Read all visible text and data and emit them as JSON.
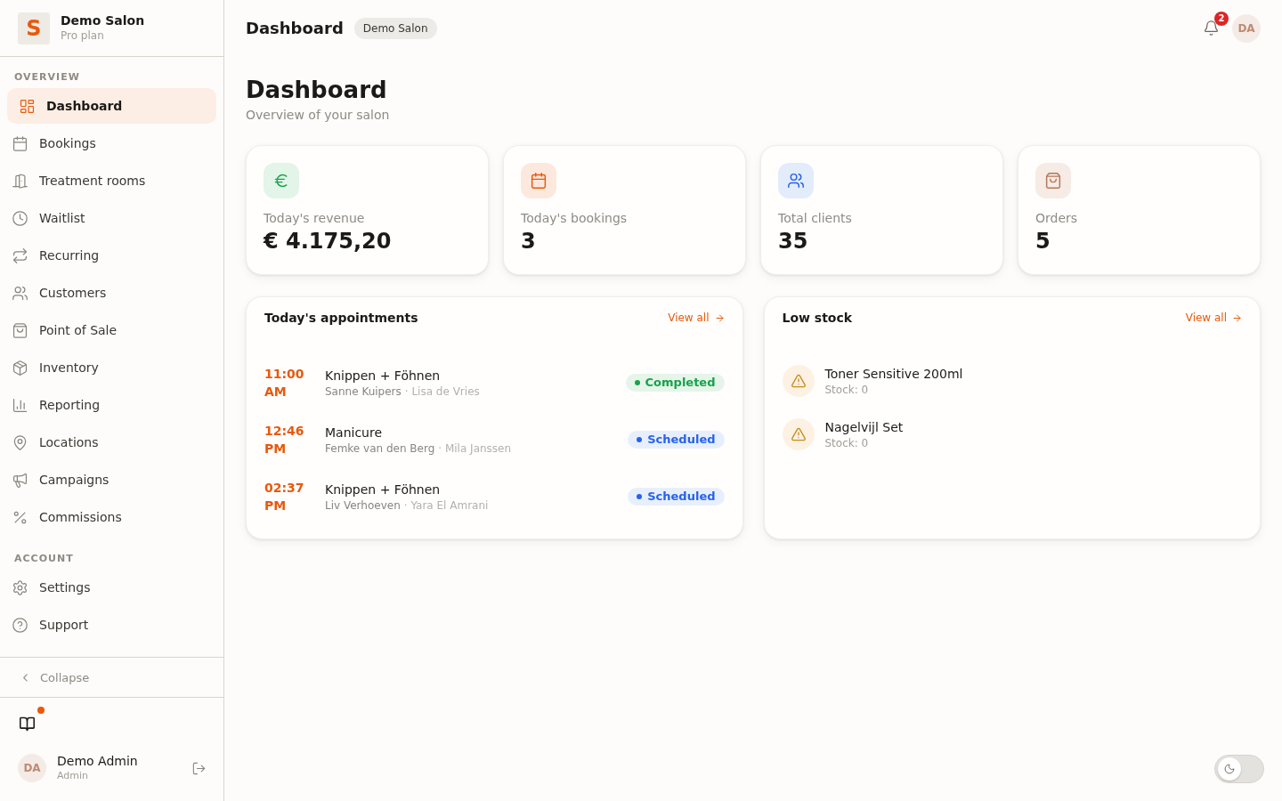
{
  "sidebar": {
    "brand": {
      "logo": "S",
      "name": "Demo Salon",
      "plan": "Pro plan"
    },
    "sections": [
      {
        "title": "OVERVIEW",
        "items": [
          {
            "label": "Dashboard",
            "selected": true
          },
          {
            "label": "Bookings",
            "selected": false
          },
          {
            "label": "Treatment rooms",
            "selected": false
          },
          {
            "label": "Waitlist",
            "selected": false
          },
          {
            "label": "Recurring",
            "selected": false
          },
          {
            "label": "Customers",
            "selected": false
          },
          {
            "label": "Point of Sale",
            "selected": false
          },
          {
            "label": "Inventory",
            "selected": false
          },
          {
            "label": "Reporting",
            "selected": false
          },
          {
            "label": "Locations",
            "selected": false
          },
          {
            "label": "Campaigns",
            "selected": false
          },
          {
            "label": "Commissions",
            "selected": false
          }
        ]
      },
      {
        "title": "ACCOUNT",
        "items": [
          {
            "label": "Settings",
            "selected": false
          },
          {
            "label": "Support",
            "selected": false
          }
        ]
      }
    ],
    "collapse": "Collapse",
    "guide_button": {
      "unread": true
    },
    "user": {
      "initials": "DA",
      "name": "Demo Admin",
      "role": "Admin"
    }
  },
  "topbar": {
    "title": "Dashboard",
    "workspace": "Demo Salon",
    "notifications": "2",
    "avatar": "DA"
  },
  "page": {
    "title": "Dashboard",
    "subtitle": "Overview of your salon"
  },
  "stats": [
    {
      "label": "Today's revenue",
      "value": "€ 4.175,20"
    },
    {
      "label": "Today's bookings",
      "value": "3"
    },
    {
      "label": "Total clients",
      "value": "35"
    },
    {
      "label": "Orders",
      "value": "5"
    }
  ],
  "appointments": {
    "title": "Today's appointments",
    "link": "View all",
    "rows": [
      {
        "time": "11:00 AM",
        "service": "Knippen + Föhnen",
        "customer": "Sanne Kuipers",
        "staff": "· Lisa de Vries",
        "status": {
          "kind": "completed",
          "label": "Completed"
        }
      },
      {
        "time": "12:46 PM",
        "service": "Manicure",
        "customer": "Femke van den Berg",
        "staff": "· Mila Janssen",
        "status": {
          "kind": "scheduled",
          "label": "Scheduled"
        }
      },
      {
        "time": "02:37 PM",
        "service": "Knippen + Föhnen",
        "customer": "Liv Verhoeven",
        "staff": "· Yara El Amrani",
        "status": {
          "kind": "scheduled",
          "label": "Scheduled"
        }
      }
    ]
  },
  "low_stock": {
    "title": "Low stock",
    "link": "View all",
    "items": [
      {
        "name": "Toner Sensitive 200ml",
        "stock": "Stock: 0"
      },
      {
        "name": "Nagelvijl Set",
        "stock": "Stock: 0"
      }
    ]
  },
  "theme_toggle": {
    "on": false
  }
}
